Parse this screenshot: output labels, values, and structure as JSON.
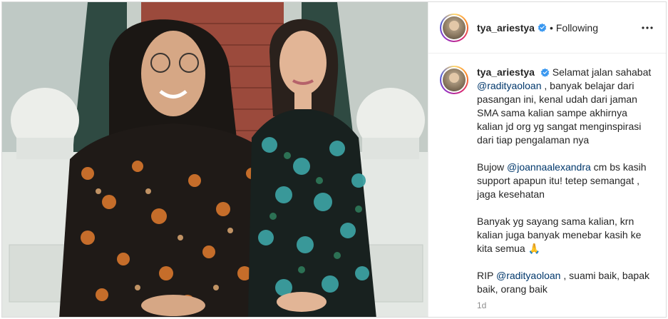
{
  "post": {
    "username": "tya_ariestya",
    "separator": "•",
    "follow_state": "Following",
    "caption": {
      "intro": "Selamat jalan sahabat",
      "mention_1": "@radityaoloan",
      "line_1_rest": " , banyak belajar dari pasangan ini, kenal udah dari jaman SMA sama kalian sampe akhirnya kalian jd org yg sangat menginspirasi dari tiap pengalaman nya",
      "p2_start": "Bujow ",
      "mention_2": "@joannaalexandra",
      "p2_rest": " cm bs kasih support apapun itu! tetep semangat , jaga kesehatan",
      "p3": "Banyak yg sayang sama kalian, krn kalian juga banyak menebar kasih ke kita semua 🙏",
      "p4_start": "RIP ",
      "mention_3": "@radityaoloan",
      "p4_rest": " , suami baik, bapak baik, orang baik"
    },
    "timestamp": "1d"
  },
  "icons": {
    "verified": "verified-badge-icon",
    "more": "more-options-icon"
  },
  "colors": {
    "verified_blue": "#3897f0",
    "mention": "#00376b",
    "muted": "#8e8e8e"
  }
}
